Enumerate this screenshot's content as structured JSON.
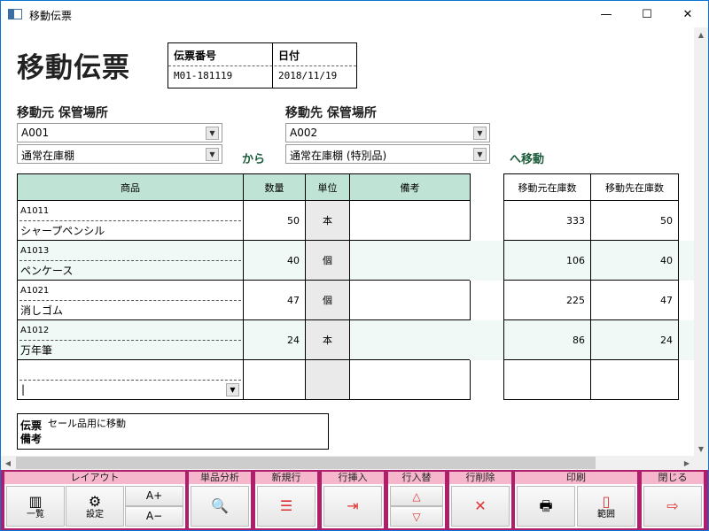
{
  "window": {
    "title": "移動伝票",
    "minimize": "—",
    "maximize": "☐",
    "close": "✕"
  },
  "header": {
    "title": "移動伝票",
    "slip_label": "伝票番号",
    "slip_value": "M01-181119",
    "date_label": "日付",
    "date_value": "2018/11/19"
  },
  "from": {
    "label": "移動元 保管場所",
    "code": "A001",
    "location": "通常在庫棚"
  },
  "kara": "から",
  "to": {
    "label": "移動先 保管場所",
    "code": "A002",
    "location": "通常在庫棚 (特別品)"
  },
  "he_idou": "へ移動",
  "table": {
    "headers": {
      "product": "商品",
      "qty": "数量",
      "unit": "単位",
      "note": "備考",
      "src_stock": "移動元在庫数",
      "dst_stock": "移動先在庫数"
    },
    "rows": [
      {
        "code": "A1011",
        "name": "シャープペンシル",
        "qty": "50",
        "unit": "本",
        "note": "",
        "src": "333",
        "dst": "50"
      },
      {
        "code": "A1013",
        "name": "ペンケース",
        "qty": "40",
        "unit": "個",
        "note": "",
        "src": "106",
        "dst": "40"
      },
      {
        "code": "A1021",
        "name": "消しゴム",
        "qty": "47",
        "unit": "個",
        "note": "",
        "src": "225",
        "dst": "47"
      },
      {
        "code": "A1012",
        "name": "万年筆",
        "qty": "24",
        "unit": "本",
        "note": "",
        "src": "86",
        "dst": "24"
      }
    ],
    "new_row_value": "|"
  },
  "memo": {
    "label1": "伝票",
    "label2": "備考",
    "text": "セール品用に移動"
  },
  "toolbar": {
    "layout": {
      "header": "レイアウト",
      "list": "一覧",
      "settings": "設定",
      "font_up": "A+",
      "font_down": "A−"
    },
    "analysis": {
      "header": "単品分析"
    },
    "new_row": {
      "header": "新規行"
    },
    "insert_row": {
      "header": "行挿入"
    },
    "swap_row": {
      "header": "行入替"
    },
    "delete_row": {
      "header": "行削除"
    },
    "print": {
      "header": "印刷",
      "range": "範囲"
    },
    "close": {
      "header": "閉じる"
    }
  },
  "colors": {
    "accent": "#b01e6b",
    "header_green": "#bfe3d4",
    "group_pink": "#f6b7cc",
    "window_border": "#0b73d6"
  }
}
